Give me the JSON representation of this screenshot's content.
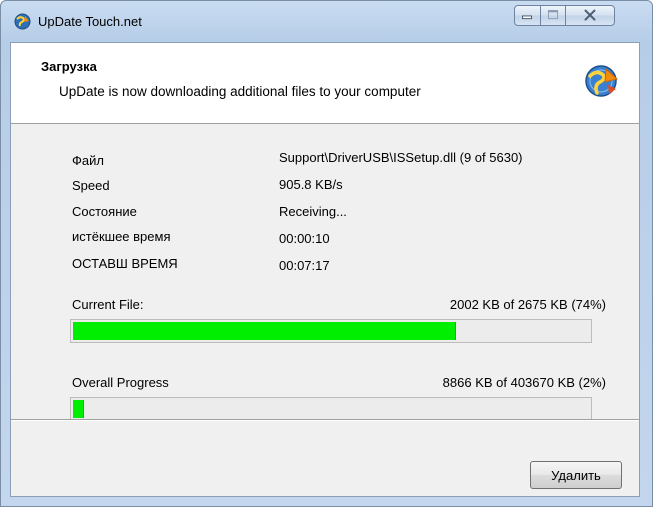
{
  "window": {
    "title": "UpDate Touch.net",
    "app_icon": "update-globe-icon"
  },
  "caption_buttons": {
    "minimize_icon": "minimize-icon",
    "maximize_icon": "maximize-icon",
    "close_icon": "close-icon"
  },
  "header": {
    "title": "Загрузка",
    "subtitle": "UpDate is now downloading additional files to your computer",
    "logo_icon": "update-globe-icon"
  },
  "info": [
    {
      "label": "Файл",
      "value": "Support\\DriverUSB\\ISSetup.dll (9 of 5630)"
    },
    {
      "label": "Speed",
      "value": "905.8 KB/s"
    },
    {
      "label": "Состояние",
      "value": "Receiving..."
    },
    {
      "label": "истёкшее время",
      "value": "00:00:10"
    },
    {
      "label": "ОСТАВШ ВРЕМЯ",
      "value": "00:07:17"
    }
  ],
  "current_file": {
    "label": "Current File:",
    "detail": "2002 KB of 2675 KB (74%)",
    "progress": 0.74
  },
  "overall": {
    "label": "Overall Progress",
    "detail": "8866 KB of 403670 KB (2%)",
    "progress": 0.02
  },
  "buttons": {
    "cancel_label": "Удалить"
  },
  "colors": {
    "progress_fill": "#00ee00",
    "title_bar": "#b6cde8"
  }
}
